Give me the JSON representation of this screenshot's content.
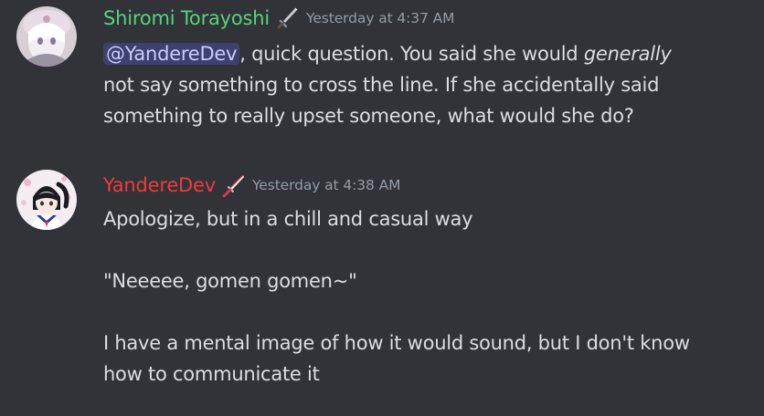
{
  "messages": [
    {
      "author": "Shiromi Torayoshi",
      "author_color": "#57d37a",
      "role_icon": "sword-icon",
      "timestamp": "Yesterday at 4:37 AM",
      "mention": "@YandereDev",
      "text_after_mention": ", quick question. You said she would ",
      "emphasis": "generally",
      "line2": "not say something to cross the line. If she accidentally said",
      "line3": "something to really upset someone, what would she do?"
    },
    {
      "author": "YandereDev",
      "author_color": "#ef3b3b",
      "role_icon": "katana-icon",
      "timestamp": "Yesterday at 4:38 AM",
      "para1": "Apologize, but in a chill and casual way",
      "para2": "\"Neeeee, gomen gomen~\"",
      "para3_line1": "I have a mental image of how it would sound, but I don't know",
      "para3_line2": "how to communicate it"
    }
  ]
}
